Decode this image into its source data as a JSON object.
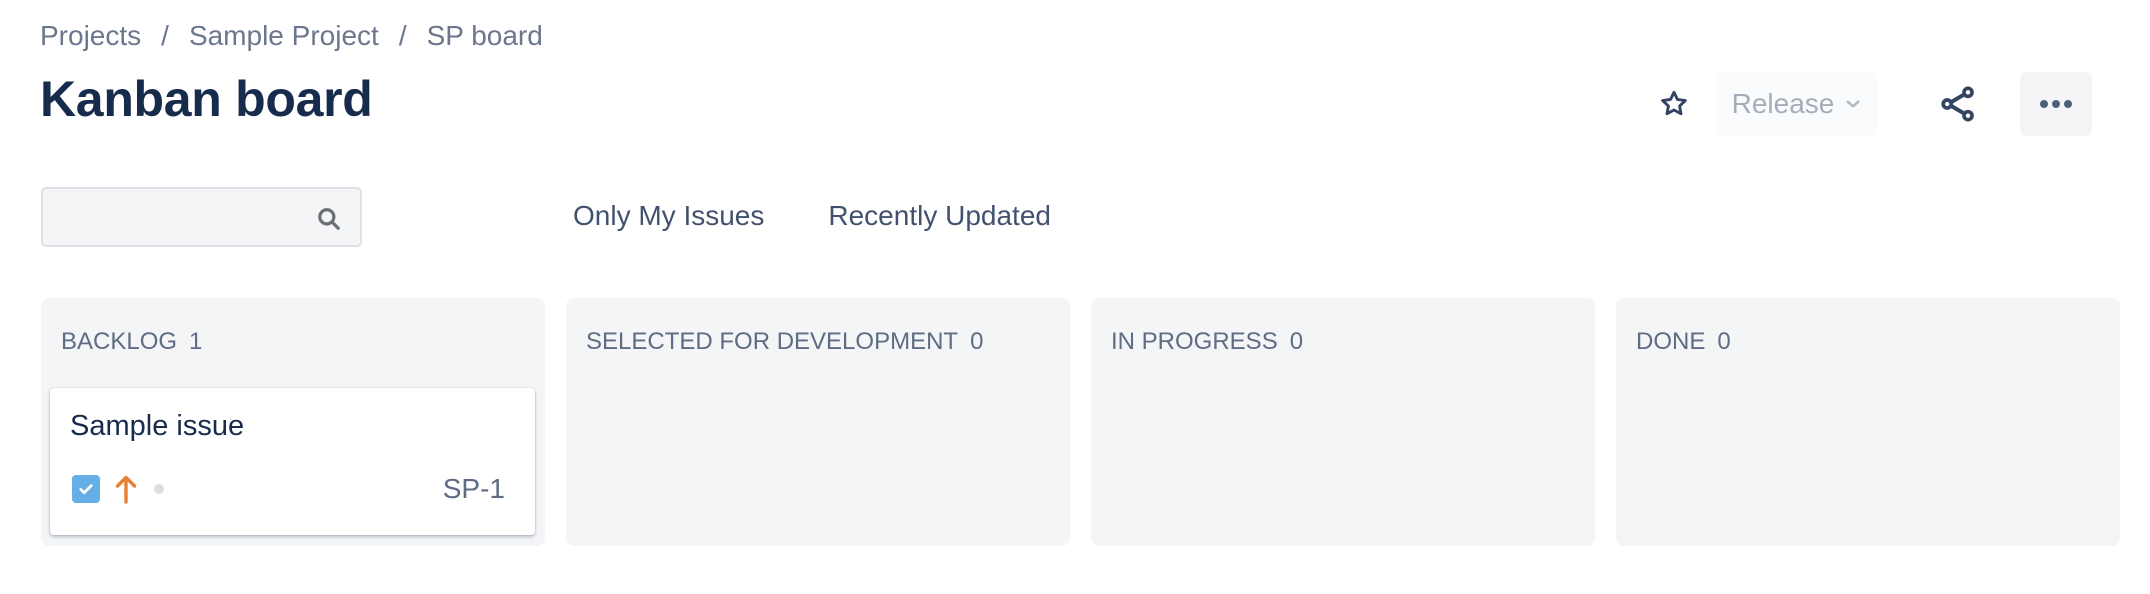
{
  "breadcrumb": {
    "items": [
      "Projects",
      "Sample Project",
      "SP board"
    ],
    "separator": "/"
  },
  "page": {
    "title": "Kanban board"
  },
  "header_actions": {
    "star_icon": "star-outline-icon",
    "release_label": "Release",
    "release_icon": "chevron-down-icon",
    "share_icon": "share-icon",
    "more_icon": "more-horizontal-icon"
  },
  "search": {
    "value": "",
    "placeholder": "",
    "icon": "search-icon"
  },
  "filters": [
    {
      "label": "Only My Issues"
    },
    {
      "label": "Recently Updated"
    }
  ],
  "columns": [
    {
      "title": "BACKLOG",
      "count": "1",
      "cards": [
        {
          "title": "Sample issue",
          "key": "SP-1",
          "issue_type_icon": "task-checkbox-icon",
          "priority_icon": "priority-high-arrow-icon",
          "status_icon": "status-dot-icon"
        }
      ]
    },
    {
      "title": "SELECTED FOR DEVELOPMENT",
      "count": "0",
      "cards": []
    },
    {
      "title": "IN PROGRESS",
      "count": "0",
      "cards": []
    },
    {
      "title": "DONE",
      "count": "0",
      "cards": []
    }
  ],
  "colors": {
    "title_text": "#172b4d",
    "breadcrumb_text": "#6b778c",
    "column_bg": "#f4f5f7",
    "task_icon": "#65aee6",
    "priority_high": "#e97f33",
    "disabled_text": "#a5adba"
  }
}
